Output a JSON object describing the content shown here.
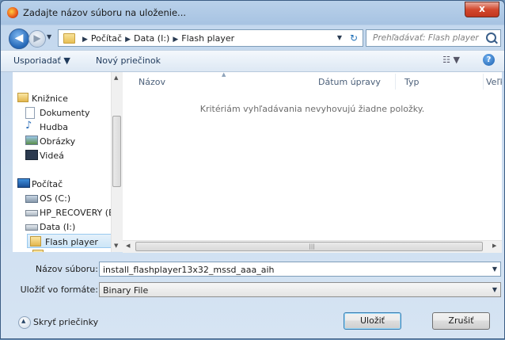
{
  "window": {
    "title": "Zadajte názov súboru na uloženie...",
    "close_glyph": "x"
  },
  "address": {
    "breadcrumb": [
      "Počítač",
      "Data (I:)",
      "Flash player"
    ],
    "search_placeholder": "Prehľadávať: Flash player"
  },
  "toolbar": {
    "organize": "Usporiadať ▼",
    "new_folder": "Nový priečinok"
  },
  "nav": {
    "items": [
      {
        "label": "Knižnice",
        "icon": "libraries-icon"
      },
      {
        "label": "Dokumenty",
        "icon": "documents-icon"
      },
      {
        "label": "Hudba",
        "icon": "music-icon"
      },
      {
        "label": "Obrázky",
        "icon": "pictures-icon"
      },
      {
        "label": "Videá",
        "icon": "videos-icon"
      },
      {
        "label": "Počítač",
        "icon": "computer-icon"
      },
      {
        "label": "OS (C:)",
        "icon": "os-drive-icon"
      },
      {
        "label": "HP_RECOVERY (E",
        "icon": "drive-icon"
      },
      {
        "label": "Data (I:)",
        "icon": "drive-icon"
      },
      {
        "label": "Flash player",
        "icon": "folder-icon"
      }
    ]
  },
  "content": {
    "columns": [
      "Názov",
      "Dátum úpravy",
      "Typ",
      "Veľko"
    ],
    "empty_message": "Kritériám vyhľadávania nevyhovujú žiadne položky."
  },
  "form": {
    "filename_label": "Názov súboru:",
    "filename_value": "install_flashplayer13x32_mssd_aaa_aih",
    "filetype_label": "Uložiť vo formáte:",
    "filetype_value": "Binary File"
  },
  "footer": {
    "hide_folders": "Skryť priečinky",
    "save": "Uložiť",
    "cancel": "Zrušiť"
  }
}
